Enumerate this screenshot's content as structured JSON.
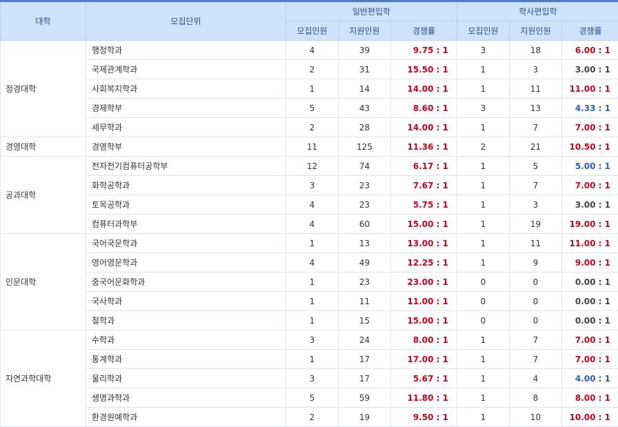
{
  "header": {
    "college": "대학",
    "unit": "모집단위",
    "general_group": "일반편입학",
    "bachelor_group": "학사편입학",
    "recruit": "모집인원",
    "applicants": "지원인원",
    "ratio": "경쟁률"
  },
  "colors": {
    "red": "#d6001c",
    "blue": "#2a5cc8",
    "gray": "#444444"
  },
  "groups": [
    {
      "college": "정경대학",
      "rows": [
        {
          "unit": "행정학과",
          "g_recruit": "4",
          "g_applicants": "39",
          "g_ratio": "9.75 : 1",
          "g_color": "red",
          "b_recruit": "3",
          "b_applicants": "18",
          "b_ratio": "6.00 : 1",
          "b_color": "red"
        },
        {
          "unit": "국제관계학과",
          "g_recruit": "2",
          "g_applicants": "31",
          "g_ratio": "15.50 : 1",
          "g_color": "red",
          "b_recruit": "1",
          "b_applicants": "3",
          "b_ratio": "3.00 : 1",
          "b_color": "gray"
        },
        {
          "unit": "사회복지학과",
          "g_recruit": "1",
          "g_applicants": "14",
          "g_ratio": "14.00 : 1",
          "g_color": "red",
          "b_recruit": "1",
          "b_applicants": "11",
          "b_ratio": "11.00 : 1",
          "b_color": "red"
        },
        {
          "unit": "경제학부",
          "g_recruit": "5",
          "g_applicants": "43",
          "g_ratio": "8.60 : 1",
          "g_color": "red",
          "b_recruit": "3",
          "b_applicants": "13",
          "b_ratio": "4.33 : 1",
          "b_color": "blue"
        },
        {
          "unit": "세무학과",
          "g_recruit": "2",
          "g_applicants": "28",
          "g_ratio": "14.00 : 1",
          "g_color": "red",
          "b_recruit": "1",
          "b_applicants": "7",
          "b_ratio": "7.00 : 1",
          "b_color": "red"
        }
      ]
    },
    {
      "college": "경영대학",
      "rows": [
        {
          "unit": "경영학부",
          "g_recruit": "11",
          "g_applicants": "125",
          "g_ratio": "11.36 : 1",
          "g_color": "red",
          "b_recruit": "2",
          "b_applicants": "21",
          "b_ratio": "10.50 : 1",
          "b_color": "red"
        }
      ]
    },
    {
      "college": "공과대학",
      "rows": [
        {
          "unit": "전자전기컴퓨터공학부",
          "g_recruit": "12",
          "g_applicants": "74",
          "g_ratio": "6.17 : 1",
          "g_color": "red",
          "b_recruit": "1",
          "b_applicants": "5",
          "b_ratio": "5.00 : 1",
          "b_color": "blue"
        },
        {
          "unit": "화학공학과",
          "g_recruit": "3",
          "g_applicants": "23",
          "g_ratio": "7.67 : 1",
          "g_color": "red",
          "b_recruit": "1",
          "b_applicants": "7",
          "b_ratio": "7.00 : 1",
          "b_color": "red"
        },
        {
          "unit": "토목공학과",
          "g_recruit": "4",
          "g_applicants": "23",
          "g_ratio": "5.75 : 1",
          "g_color": "red",
          "b_recruit": "1",
          "b_applicants": "3",
          "b_ratio": "3.00 : 1",
          "b_color": "gray"
        },
        {
          "unit": "컴퓨터과학부",
          "g_recruit": "4",
          "g_applicants": "60",
          "g_ratio": "15.00 : 1",
          "g_color": "red",
          "b_recruit": "1",
          "b_applicants": "19",
          "b_ratio": "19.00 : 1",
          "b_color": "red"
        }
      ]
    },
    {
      "college": "인문대학",
      "rows": [
        {
          "unit": "국어국문학과",
          "g_recruit": "1",
          "g_applicants": "13",
          "g_ratio": "13.00 : 1",
          "g_color": "red",
          "b_recruit": "1",
          "b_applicants": "11",
          "b_ratio": "11.00 : 1",
          "b_color": "red"
        },
        {
          "unit": "영어영문학과",
          "g_recruit": "4",
          "g_applicants": "49",
          "g_ratio": "12.25 : 1",
          "g_color": "red",
          "b_recruit": "1",
          "b_applicants": "9",
          "b_ratio": "9.00 : 1",
          "b_color": "red"
        },
        {
          "unit": "중국어문화학과",
          "g_recruit": "1",
          "g_applicants": "23",
          "g_ratio": "23.00 : 1",
          "g_color": "red",
          "b_recruit": "0",
          "b_applicants": "0",
          "b_ratio": "0.00 : 1",
          "b_color": "gray"
        },
        {
          "unit": "국사학과",
          "g_recruit": "1",
          "g_applicants": "11",
          "g_ratio": "11.00 : 1",
          "g_color": "red",
          "b_recruit": "0",
          "b_applicants": "0",
          "b_ratio": "0.00 : 1",
          "b_color": "gray"
        },
        {
          "unit": "철학과",
          "g_recruit": "1",
          "g_applicants": "15",
          "g_ratio": "15.00 : 1",
          "g_color": "red",
          "b_recruit": "0",
          "b_applicants": "0",
          "b_ratio": "0.00 : 1",
          "b_color": "gray"
        }
      ]
    },
    {
      "college": "자연과학대학",
      "rows": [
        {
          "unit": "수학과",
          "g_recruit": "3",
          "g_applicants": "24",
          "g_ratio": "8.00 : 1",
          "g_color": "red",
          "b_recruit": "1",
          "b_applicants": "7",
          "b_ratio": "7.00 : 1",
          "b_color": "red"
        },
        {
          "unit": "통계학과",
          "g_recruit": "1",
          "g_applicants": "17",
          "g_ratio": "17.00 : 1",
          "g_color": "red",
          "b_recruit": "1",
          "b_applicants": "7",
          "b_ratio": "7.00 : 1",
          "b_color": "red"
        },
        {
          "unit": "물리학과",
          "g_recruit": "3",
          "g_applicants": "17",
          "g_ratio": "5.67 : 1",
          "g_color": "red",
          "b_recruit": "1",
          "b_applicants": "4",
          "b_ratio": "4.00 : 1",
          "b_color": "blue"
        },
        {
          "unit": "생명과학과",
          "g_recruit": "5",
          "g_applicants": "59",
          "g_ratio": "11.80 : 1",
          "g_color": "red",
          "b_recruit": "1",
          "b_applicants": "8",
          "b_ratio": "8.00 : 1",
          "b_color": "red"
        },
        {
          "unit": "환경원예학과",
          "g_recruit": "2",
          "g_applicants": "19",
          "g_ratio": "9.50 : 1",
          "g_color": "red",
          "b_recruit": "1",
          "b_applicants": "10",
          "b_ratio": "10.00 : 1",
          "b_color": "red"
        }
      ]
    }
  ]
}
